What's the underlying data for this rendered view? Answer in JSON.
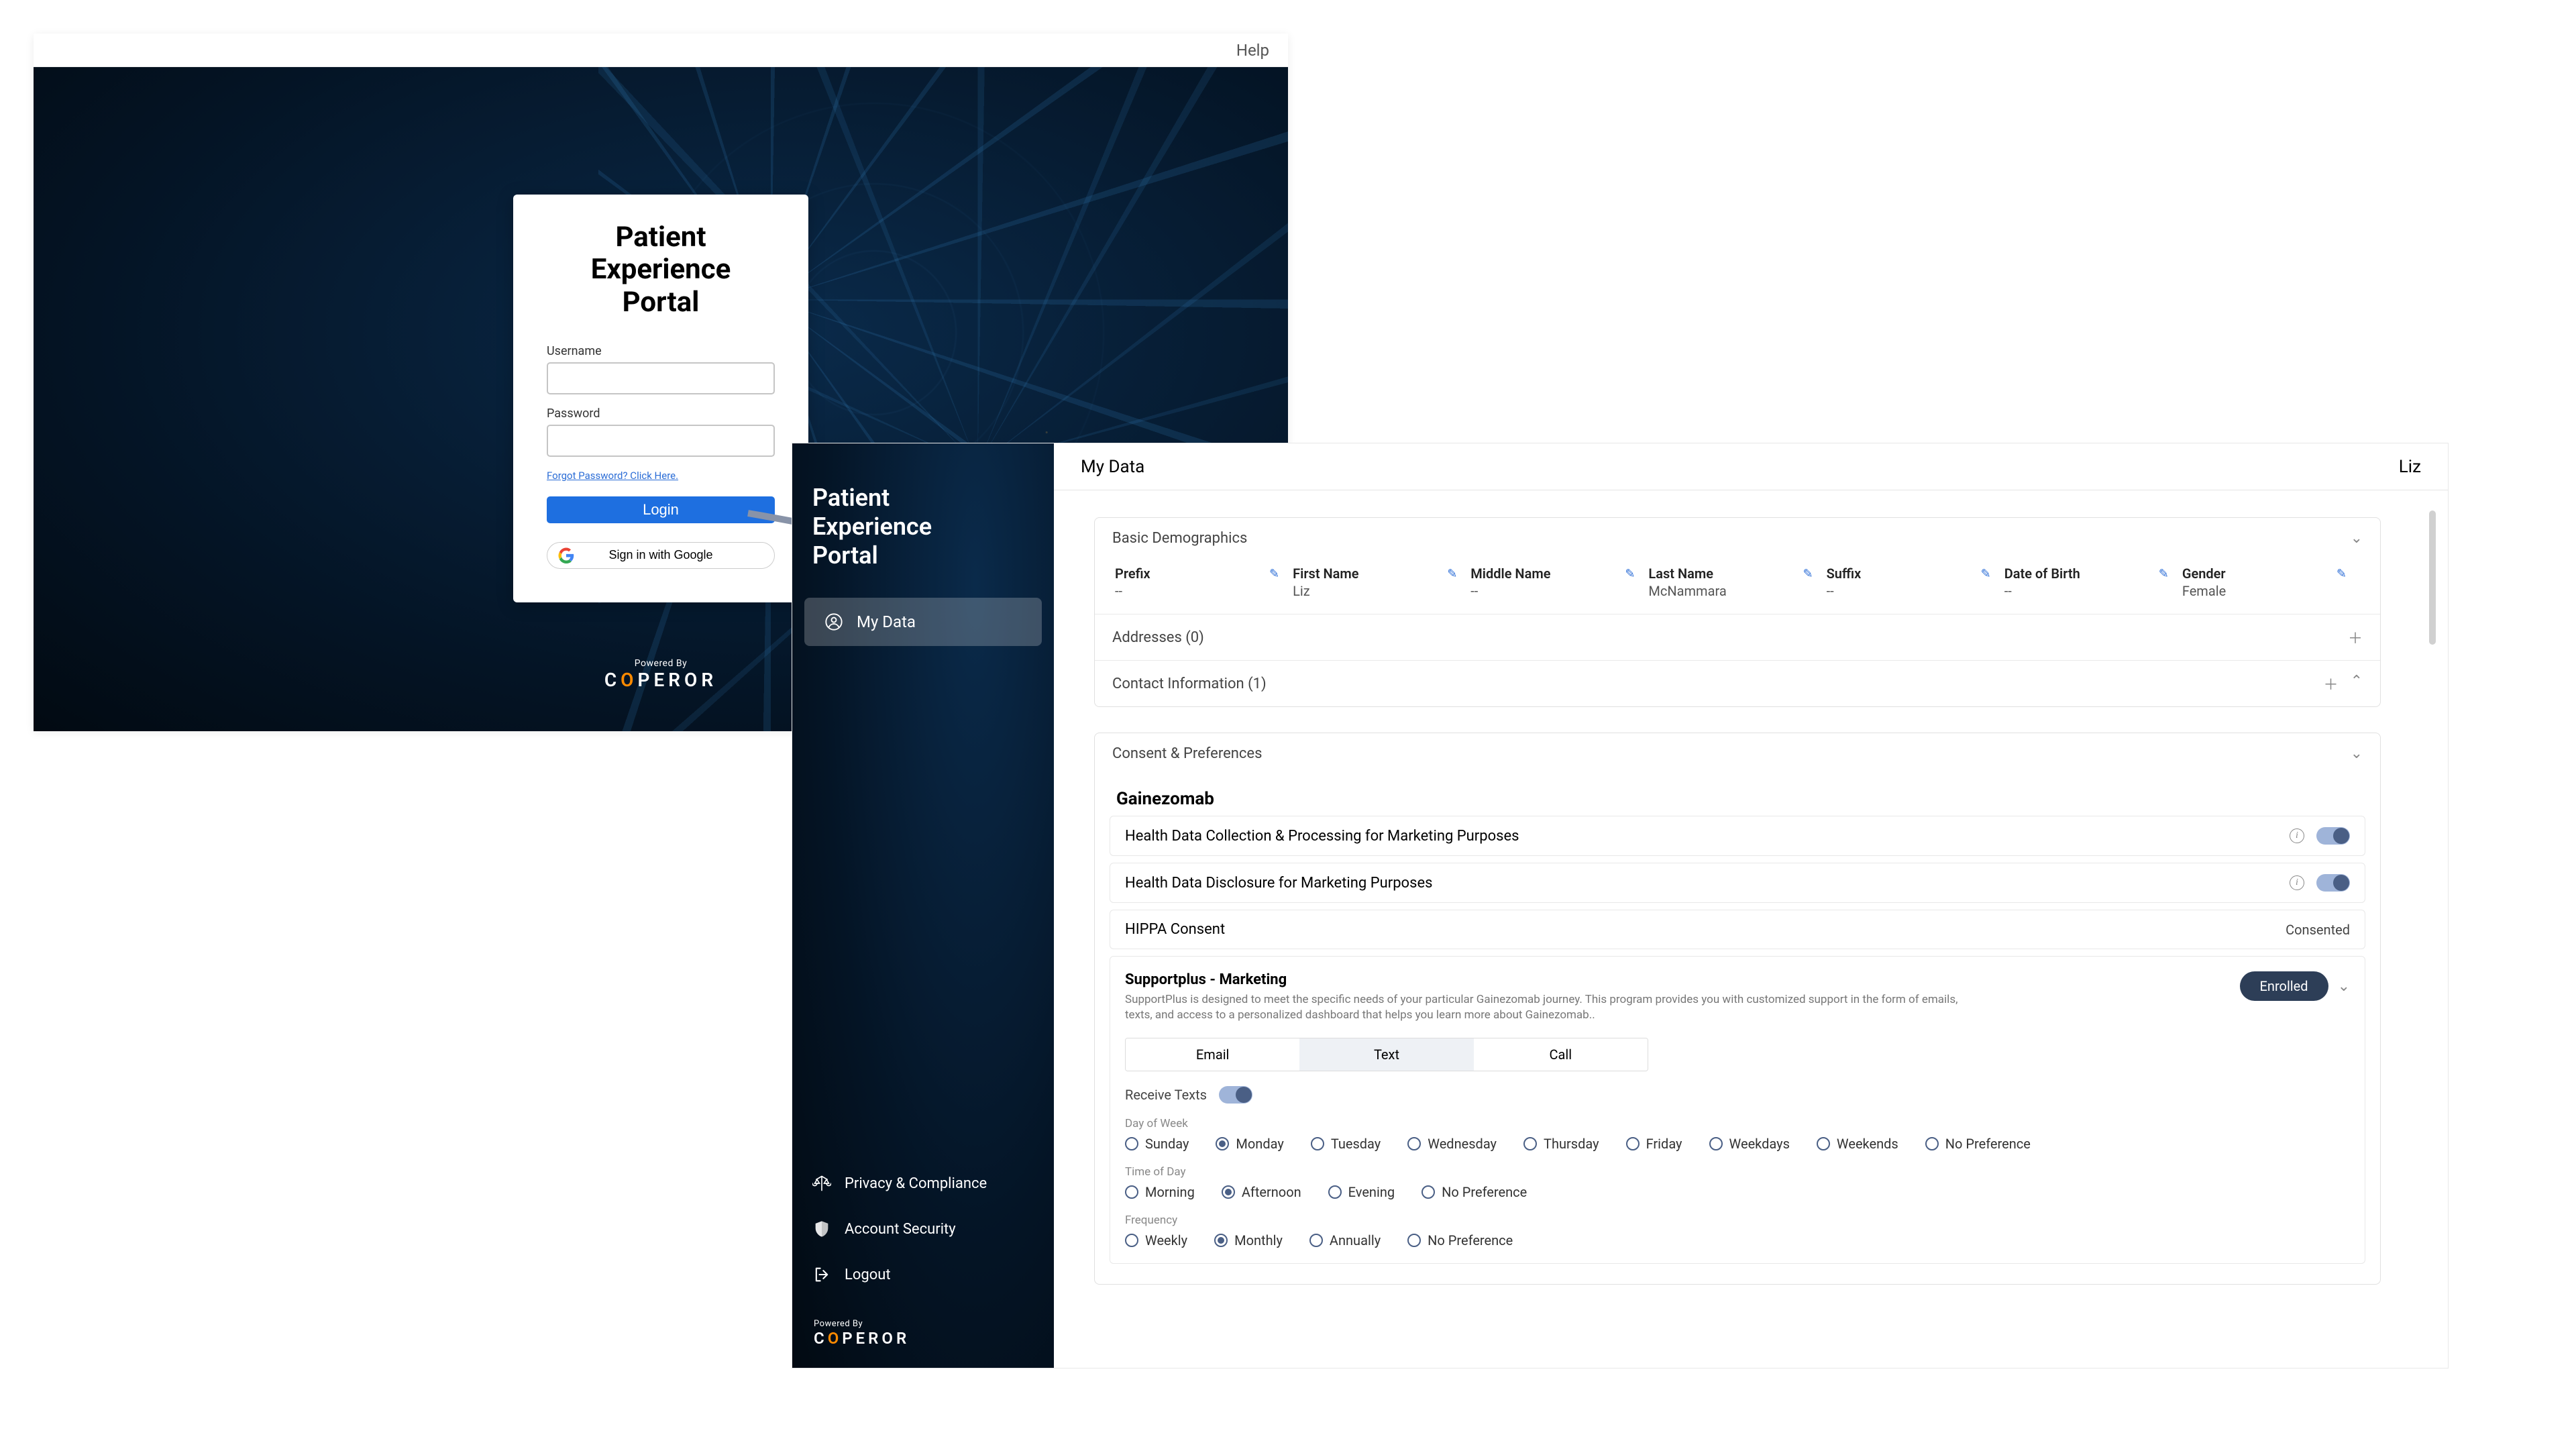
{
  "login": {
    "help": "Help",
    "title_line1": "Patient Experience",
    "title_line2": "Portal",
    "username_label": "Username",
    "password_label": "Password",
    "forgot": "Forgot Password? Click Here.",
    "login_btn": "Login",
    "google_btn": "Sign in with Google",
    "powered_by": "Powered By",
    "brand": "COPEROR"
  },
  "sidebar": {
    "title_line1": "Patient",
    "title_line2": "Experience",
    "title_line3": "Portal",
    "items": [
      {
        "label": "My Data"
      }
    ],
    "bottom": [
      {
        "label": "Privacy & Compliance"
      },
      {
        "label": "Account Security"
      },
      {
        "label": "Logout"
      }
    ],
    "powered_by": "Powered By",
    "brand": "COPEROR"
  },
  "header": {
    "page_title": "My Data",
    "user": "Liz"
  },
  "demographics": {
    "header": "Basic Demographics",
    "cols": [
      {
        "label": "Prefix",
        "value": "--"
      },
      {
        "label": "First Name",
        "value": "Liz"
      },
      {
        "label": "Middle Name",
        "value": "--"
      },
      {
        "label": "Last Name",
        "value": "McNammara"
      },
      {
        "label": "Suffix",
        "value": "--"
      },
      {
        "label": "Date of Birth",
        "value": "--"
      },
      {
        "label": "Gender",
        "value": "Female"
      }
    ],
    "addresses": "Addresses (0)",
    "contact": "Contact Information (1)"
  },
  "consent": {
    "header": "Consent & Preferences",
    "product": "Gainezomab",
    "rows": [
      {
        "label": "Health Data Collection & Processing for Marketing Purposes",
        "type": "toggle",
        "on": true
      },
      {
        "label": "Health Data Disclosure for Marketing Purposes",
        "type": "toggle",
        "on": true
      },
      {
        "label": "HIPPA Consent",
        "type": "text",
        "status": "Consented"
      }
    ],
    "detail": {
      "title": "Supportplus - Marketing",
      "desc": "SupportPlus is designed to meet the specific needs of your particular Gainezomab journey. This program provides you with customized support in the form of emails, texts, and access to a personalized dashboard that helps you learn more about Gainezomab..",
      "enrolled": "Enrolled",
      "tabs": [
        "Email",
        "Text",
        "Call"
      ],
      "active_tab": 1,
      "receive_label": "Receive Texts",
      "groups": [
        {
          "label": "Day of Week",
          "options": [
            "Sunday",
            "Monday",
            "Tuesday",
            "Wednesday",
            "Thursday",
            "Friday",
            "Weekdays",
            "Weekends",
            "No Preference"
          ],
          "selected": "Monday"
        },
        {
          "label": "Time of Day",
          "options": [
            "Morning",
            "Afternoon",
            "Evening",
            "No Preference"
          ],
          "selected": "Afternoon"
        },
        {
          "label": "Frequency",
          "options": [
            "Weekly",
            "Monthly",
            "Annually",
            "No Preference"
          ],
          "selected": "Monthly"
        }
      ]
    }
  }
}
